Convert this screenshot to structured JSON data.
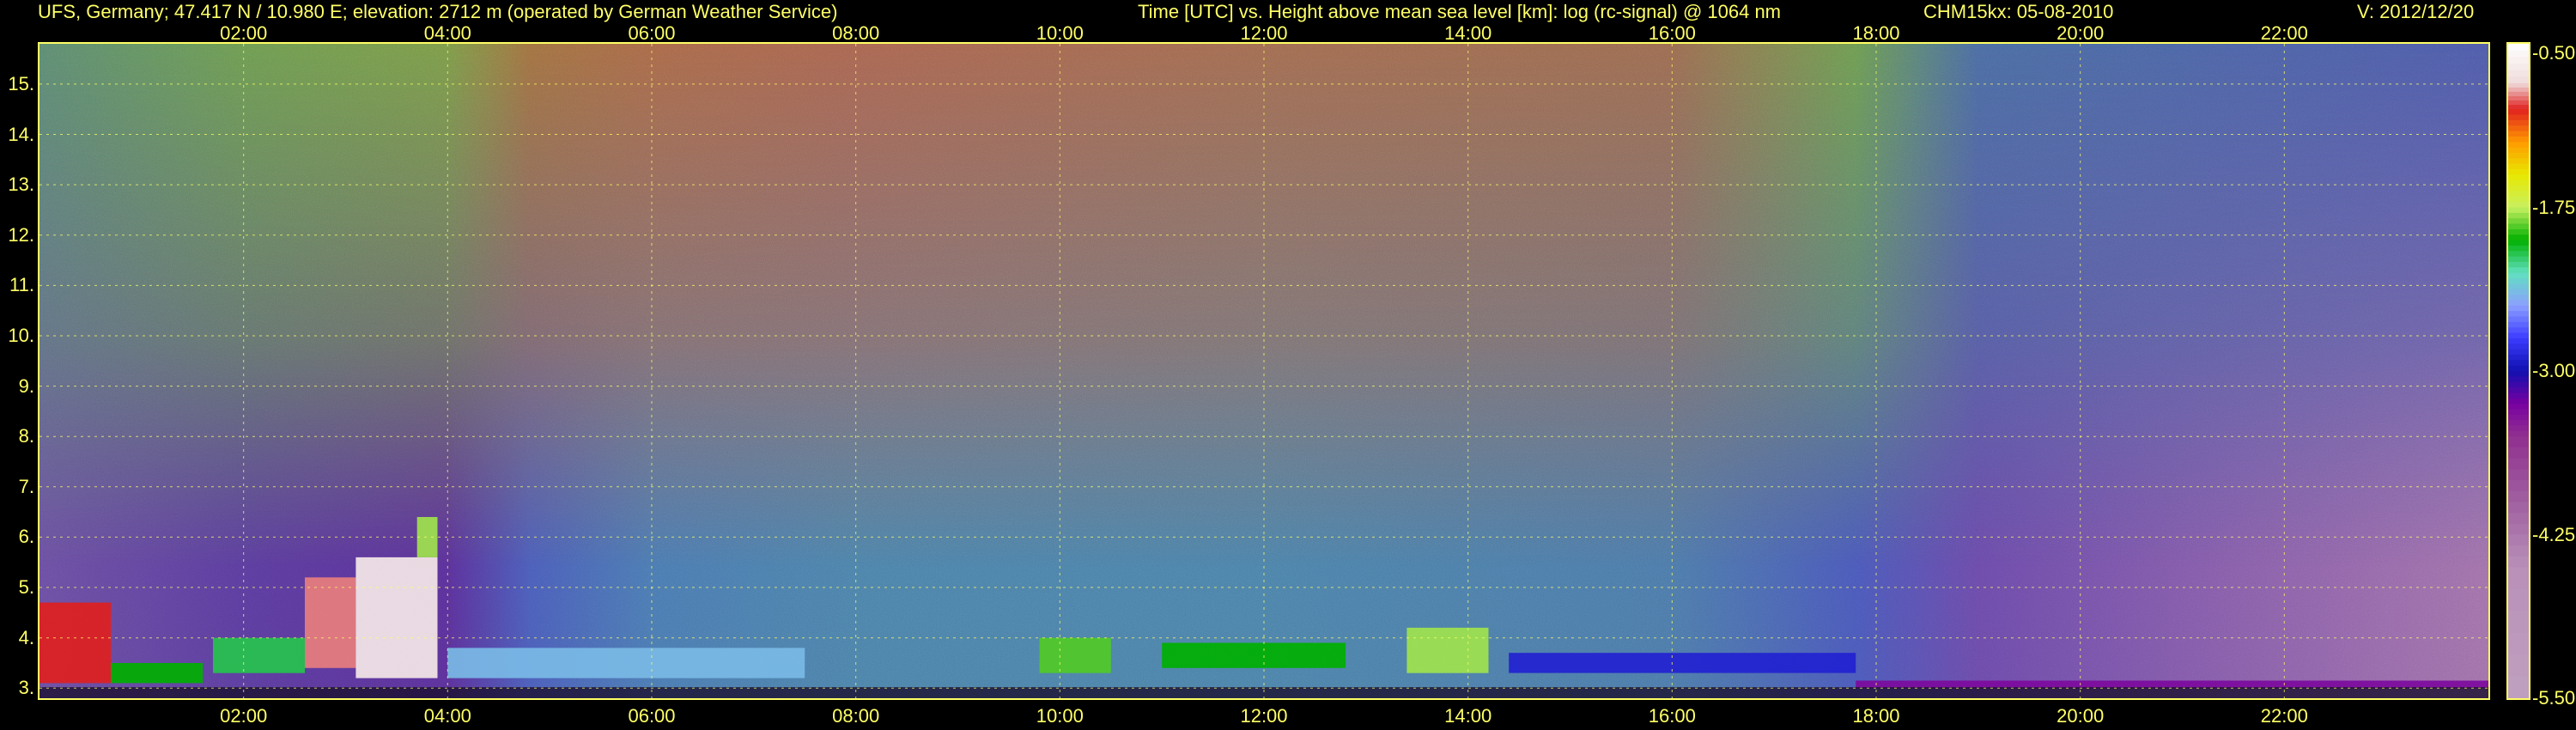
{
  "header": {
    "site": "UFS, Germany; 47.417 N / 10.980 E; elevation: 2712 m  (operated by German Weather Service)",
    "title": "Time [UTC] vs. Height above mean sea level [km]: log (rc-signal) @ 1064 nm",
    "instrument_date": "CHM15kx: 05-08-2010",
    "version": "V: 2012/12/20"
  },
  "chart_data": {
    "type": "heatmap",
    "title": "Time [UTC] vs. Height above mean sea level [km]: log (rc-signal) @ 1064 nm",
    "xlabel": "Time [UTC]",
    "ylabel": "Height above mean sea level [km]",
    "xlim": [
      0,
      24
    ],
    "ylim": [
      2.8,
      15.8
    ],
    "grid": true,
    "x_ticks": [
      {
        "value": 2,
        "label": "02:00"
      },
      {
        "value": 4,
        "label": "04:00"
      },
      {
        "value": 6,
        "label": "06:00"
      },
      {
        "value": 8,
        "label": "08:00"
      },
      {
        "value": 10,
        "label": "10:00"
      },
      {
        "value": 12,
        "label": "12:00"
      },
      {
        "value": 14,
        "label": "14:00"
      },
      {
        "value": 16,
        "label": "16:00"
      },
      {
        "value": 18,
        "label": "18:00"
      },
      {
        "value": 20,
        "label": "20:00"
      },
      {
        "value": 22,
        "label": "22:00"
      }
    ],
    "y_ticks": [
      {
        "value": 3,
        "label": "3."
      },
      {
        "value": 4,
        "label": "4."
      },
      {
        "value": 5,
        "label": "5."
      },
      {
        "value": 6,
        "label": "6."
      },
      {
        "value": 7,
        "label": "7."
      },
      {
        "value": 8,
        "label": "8."
      },
      {
        "value": 9,
        "label": "9."
      },
      {
        "value": 10,
        "label": "10."
      },
      {
        "value": 11,
        "label": "11."
      },
      {
        "value": 12,
        "label": "12."
      },
      {
        "value": 13,
        "label": "13."
      },
      {
        "value": 14,
        "label": "14."
      },
      {
        "value": 15,
        "label": "15."
      }
    ],
    "colorbar": {
      "range": [
        -5.5,
        -0.5
      ],
      "ticks": [
        {
          "value": -0.5,
          "label": "-0.50"
        },
        {
          "value": -1.75,
          "label": "-1.75"
        },
        {
          "value": -3.0,
          "label": "-3.00"
        },
        {
          "value": -4.25,
          "label": "-4.25"
        },
        {
          "value": -5.5,
          "label": "-5.50"
        }
      ],
      "stops": [
        {
          "value": -0.5,
          "color": "#ffffff"
        },
        {
          "value": -0.8,
          "color": "#f0dcdc"
        },
        {
          "value": -1.0,
          "color": "#e02020"
        },
        {
          "value": -1.25,
          "color": "#ff9900"
        },
        {
          "value": -1.5,
          "color": "#e8e800"
        },
        {
          "value": -1.75,
          "color": "#c8f060"
        },
        {
          "value": -2.0,
          "color": "#00b000"
        },
        {
          "value": -2.25,
          "color": "#60e0c0"
        },
        {
          "value": -2.5,
          "color": "#8ca0ff"
        },
        {
          "value": -2.75,
          "color": "#3c3cff"
        },
        {
          "value": -3.0,
          "color": "#1010b0"
        },
        {
          "value": -3.25,
          "color": "#7800a0"
        },
        {
          "value": -3.5,
          "color": "#903090"
        },
        {
          "value": -4.0,
          "color": "#a060a0"
        },
        {
          "value": -4.5,
          "color": "#b890b8"
        },
        {
          "value": -5.5,
          "color": "#c0a0c0"
        }
      ]
    },
    "background_field": [
      {
        "time": 0.0,
        "color": "#6a4ea0",
        "upper_color": "#5c8a70"
      },
      {
        "time": 2.0,
        "color": "#5a3c9c",
        "upper_color": "#6c9a50"
      },
      {
        "time": 4.0,
        "color": "#5a3098",
        "upper_color": "#7a9a48"
      },
      {
        "time": 4.8,
        "color": "#4a5cb8",
        "upper_color": "#a07040"
      },
      {
        "time": 6.0,
        "color": "#4a78b0",
        "upper_color": "#a86848"
      },
      {
        "time": 8.0,
        "color": "#4c80a8",
        "upper_color": "#a86450"
      },
      {
        "time": 12.0,
        "color": "#4c80a8",
        "upper_color": "#a06a50"
      },
      {
        "time": 16.0,
        "color": "#4c78a8",
        "upper_color": "#9a6a50"
      },
      {
        "time": 17.8,
        "color": "#4a58b8",
        "upper_color": "#6c9a50"
      },
      {
        "time": 19.0,
        "color": "#6a4aa8",
        "upper_color": "#4a6aa0"
      },
      {
        "time": 24.0,
        "color": "#a070a8",
        "upper_color": "#4e5aa8"
      }
    ],
    "cloud_layers": [
      {
        "t_start": 0.0,
        "t_end": 0.7,
        "h_bottom": 3.1,
        "h_top": 4.7,
        "signal": -1.0
      },
      {
        "t_start": 0.7,
        "t_end": 1.6,
        "h_bottom": 3.1,
        "h_top": 3.5,
        "signal": -2.0
      },
      {
        "t_start": 1.7,
        "t_end": 2.6,
        "h_bottom": 3.3,
        "h_top": 4.0,
        "signal": -2.1
      },
      {
        "t_start": 2.6,
        "t_end": 3.1,
        "h_bottom": 3.4,
        "h_top": 5.2,
        "signal": -0.9
      },
      {
        "t_start": 3.1,
        "t_end": 3.9,
        "h_bottom": 3.2,
        "h_top": 5.6,
        "signal": -0.7
      },
      {
        "t_start": 3.7,
        "t_end": 3.9,
        "h_bottom": 5.6,
        "h_top": 6.4,
        "signal": -1.8
      },
      {
        "t_start": 4.0,
        "t_end": 7.5,
        "h_bottom": 3.2,
        "h_top": 3.8,
        "signal": -2.4
      },
      {
        "t_start": 9.8,
        "t_end": 10.5,
        "h_bottom": 3.3,
        "h_top": 4.0,
        "signal": -1.9
      },
      {
        "t_start": 11.0,
        "t_end": 12.8,
        "h_bottom": 3.4,
        "h_top": 3.9,
        "signal": -2.0
      },
      {
        "t_start": 13.4,
        "t_end": 14.2,
        "h_bottom": 3.3,
        "h_top": 4.2,
        "signal": -1.8
      },
      {
        "t_start": 14.4,
        "t_end": 17.8,
        "h_bottom": 3.3,
        "h_top": 3.7,
        "signal": -2.9
      },
      {
        "t_start": 17.8,
        "t_end": 24.0,
        "h_bottom": 3.0,
        "h_top": 3.15,
        "signal": -3.3
      }
    ]
  }
}
